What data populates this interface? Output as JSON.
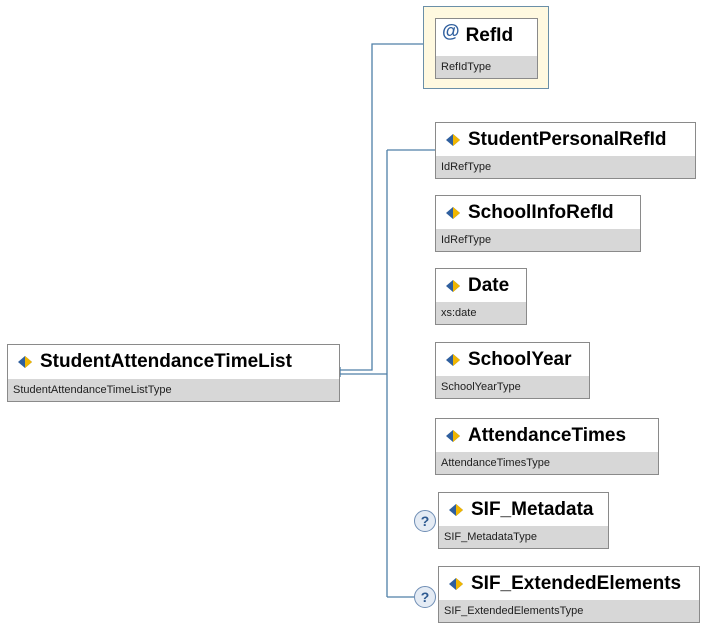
{
  "root": {
    "name": "StudentAttendanceTimeList",
    "type": "StudentAttendanceTimeListType"
  },
  "attribute": {
    "symbol": "@",
    "name": "RefId",
    "type": "RefIdType"
  },
  "elements": [
    {
      "name": "StudentPersonalRefId",
      "type": "IdRefType",
      "optional": false
    },
    {
      "name": "SchoolInfoRefId",
      "type": "IdRefType",
      "optional": false
    },
    {
      "name": "Date",
      "type": "xs:date",
      "optional": false
    },
    {
      "name": "SchoolYear",
      "type": "SchoolYearType",
      "optional": false
    },
    {
      "name": "AttendanceTimes",
      "type": "AttendanceTimesType",
      "optional": false
    },
    {
      "name": "SIF_Metadata",
      "type": "SIF_MetadataType",
      "optional": true
    },
    {
      "name": "SIF_ExtendedElements",
      "type": "SIF_ExtendedElementsType",
      "optional": true
    }
  ],
  "optional_marker": "?",
  "colors": {
    "connector": "#4f7fa8",
    "type_band": "#d7d7d7",
    "attribute_bg": "#fff9e0",
    "icon_blue": "#2f5f9e",
    "icon_gold": "#f1b600"
  }
}
